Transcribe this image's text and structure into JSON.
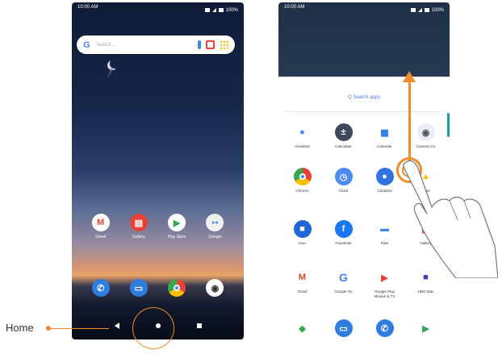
{
  "callout": {
    "label": "Home"
  },
  "home_screen": {
    "status": {
      "time": "10:00 AM",
      "battery": "100%"
    },
    "search": {
      "placeholder": "Search..."
    },
    "apps_row": [
      {
        "label": "Gmail",
        "icon": "gmail-icon",
        "color": "#ffffff"
      },
      {
        "label": "Gallery",
        "icon": "gallery-icon",
        "color": "#e94235"
      },
      {
        "label": "Play Store",
        "icon": "play-store-icon",
        "color": "#ffffff"
      },
      {
        "label": "Google",
        "icon": "google-folder-icon",
        "color": "#f1f1f1"
      }
    ],
    "dock": [
      {
        "label": "Phone",
        "icon": "phone-icon",
        "color": "#2f7de1"
      },
      {
        "label": "Messages",
        "icon": "messages-icon",
        "color": "#2f7de1"
      },
      {
        "label": "Chrome",
        "icon": "chrome-icon",
        "color": "#ffffff"
      },
      {
        "label": "Camera",
        "icon": "camera-icon",
        "color": "#ffffff"
      }
    ]
  },
  "drawer": {
    "status": {
      "time": "10:00 AM",
      "battery": "100%"
    },
    "search_label": "Q  Search apps",
    "rows": [
      [
        {
          "label": "Assistant",
          "icon": "assistant-icon",
          "color": "#ffffff"
        },
        {
          "label": "Calculator",
          "icon": "calculator-icon",
          "color": "#3c4a5c"
        },
        {
          "label": "Calendar",
          "icon": "calendar-icon",
          "color": "#ffffff"
        },
        {
          "label": "Camera Go",
          "icon": "camera-icon",
          "color": "#e9eef7"
        }
      ],
      [
        {
          "label": "Chrome",
          "icon": "chrome-icon",
          "color": "#ffffff"
        },
        {
          "label": "Clock",
          "icon": "clock-icon",
          "color": "#4a8bf5"
        },
        {
          "label": "Contacts",
          "icon": "contacts-icon",
          "color": "#2f74e0"
        },
        {
          "label": "Drive",
          "icon": "drive-icon",
          "color": "#ffffff"
        }
      ],
      [
        {
          "label": "Duo",
          "icon": "duo-icon",
          "color": "#1e66d8"
        },
        {
          "label": "Facebook",
          "icon": "facebook-icon",
          "color": "#1877f2"
        },
        {
          "label": "Files",
          "icon": "files-icon",
          "color": "#ffffff"
        },
        {
          "label": "Gallery",
          "icon": "gallery-icon",
          "color": "#ffffff"
        }
      ],
      [
        {
          "label": "Gmail",
          "icon": "gmail-icon",
          "color": "#ffffff"
        },
        {
          "label": "Google Go",
          "icon": "google-icon",
          "color": "#ffffff"
        },
        {
          "label": "Google Play\nMovies & TV",
          "icon": "play-movies-icon",
          "color": "#ffffff"
        },
        {
          "label": "HBO Max",
          "icon": "hbo-max-icon",
          "color": "#ffffff"
        }
      ],
      [
        {
          "label": "",
          "icon": "maps-icon",
          "color": "#ffffff"
        },
        {
          "label": "",
          "icon": "messages-icon",
          "color": "#2f7de1"
        },
        {
          "label": "",
          "icon": "phone-icon",
          "color": "#2f7de1"
        },
        {
          "label": "",
          "icon": "play-store-icon",
          "color": "#ffffff"
        }
      ]
    ]
  }
}
